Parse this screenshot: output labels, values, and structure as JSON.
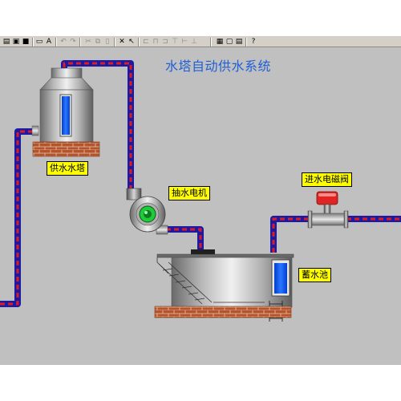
{
  "title": "水塔自动供水系统",
  "labels": {
    "water_tower": "供水水塔",
    "pump_motor": "抽水电机",
    "solenoid_valve": "进水电磁阀",
    "reservoir": "蓄水池"
  },
  "pump_status": "running",
  "colors": {
    "background": "#c0c0c0",
    "title": "#1f5fd8",
    "label_bg": "#ffff00",
    "pipe_outer": "#1a1aa6",
    "pipe_dash": "#e01b1b",
    "water": "#0b57ff",
    "brick": "#b5532d",
    "valve_head": "#e02424",
    "pump_running": "#1ecc3a"
  },
  "toolbar": {
    "buttons": [
      {
        "icon": "print-icon"
      },
      {
        "icon": "print-preview-icon"
      },
      {
        "icon": "save-icon"
      },
      {
        "icon": "page-setup-icon"
      },
      {
        "icon": "text-icon"
      },
      {
        "icon": "undo-icon"
      },
      {
        "icon": "redo-icon"
      },
      {
        "icon": "cut-icon"
      },
      {
        "icon": "copy-icon"
      },
      {
        "icon": "paste-icon"
      },
      {
        "icon": "tools-icon"
      },
      {
        "icon": "select-icon"
      },
      {
        "icon": "align-left-icon"
      },
      {
        "icon": "align-center-icon"
      },
      {
        "icon": "align-right-icon"
      },
      {
        "icon": "align-top-icon"
      },
      {
        "icon": "align-middle-icon"
      },
      {
        "icon": "align-bottom-icon"
      },
      {
        "icon": "grid-icon"
      },
      {
        "icon": "window-icon"
      },
      {
        "icon": "properties-icon"
      },
      {
        "icon": "layer-icon"
      },
      {
        "icon": "help-icon"
      }
    ]
  }
}
